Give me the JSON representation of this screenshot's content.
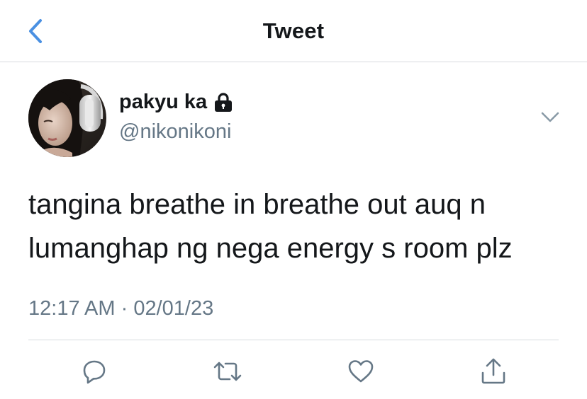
{
  "header": {
    "title": "Tweet",
    "back_icon": "chevron-left-icon",
    "accent_color": "#4a90e2"
  },
  "author": {
    "display_name": "pakyu ka",
    "handle": "@nikonikoni",
    "protected_icon": "lock-icon",
    "menu_icon": "chevron-down-icon"
  },
  "tweet": {
    "text_line_1": "tangina breathe in breathe out auq n",
    "text_line_2": "lumanghap ng nega energy s room plz",
    "time": "12:17 AM",
    "separator": "·",
    "date": "02/01/23"
  },
  "actions": {
    "reply_icon": "reply-icon",
    "retweet_icon": "retweet-icon",
    "like_icon": "heart-icon",
    "share_icon": "share-icon",
    "icon_color": "#657786"
  }
}
